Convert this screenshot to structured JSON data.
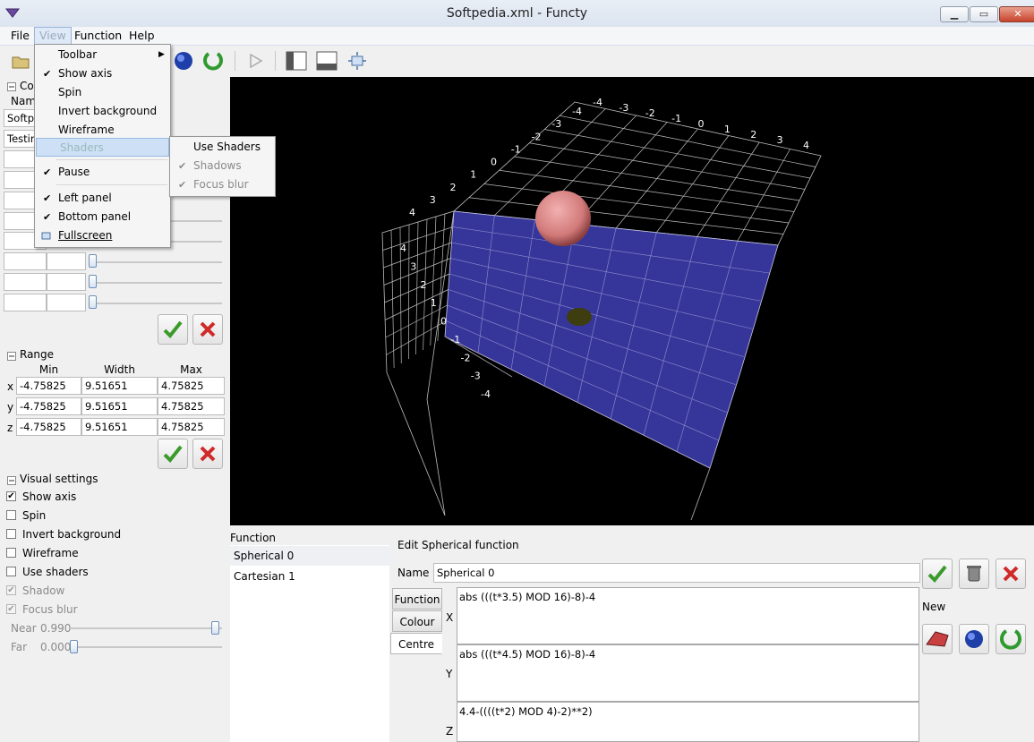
{
  "window": {
    "title": "Softpedia.xml - Functy"
  },
  "menubar": {
    "file": "File",
    "view": "View",
    "function": "Function",
    "help": "Help"
  },
  "view_menu": {
    "toolbar": "Toolbar",
    "show_axis": "Show axis",
    "spin": "Spin",
    "invert_background": "Invert background",
    "wireframe": "Wireframe",
    "shaders": "Shaders",
    "pause": "Pause",
    "left_panel": "Left panel",
    "bottom_panel": "Bottom panel",
    "fullscreen": "Fullscreen"
  },
  "shaders_menu": {
    "use_shaders": "Use Shaders",
    "shadows": "Shadows",
    "focus_blur": "Focus blur"
  },
  "left": {
    "controls_header": "Co",
    "name_header": "Nam",
    "rows": [
      "Softp",
      "Testin"
    ]
  },
  "range": {
    "title": "Range",
    "headers": {
      "min": "Min",
      "width": "Width",
      "max": "Max"
    },
    "rows": [
      {
        "axis": "x",
        "min": "-4.75825",
        "width": "9.51651",
        "max": "4.75825"
      },
      {
        "axis": "y",
        "min": "-4.75825",
        "width": "9.51651",
        "max": "4.75825"
      },
      {
        "axis": "z",
        "min": "-4.75825",
        "width": "9.51651",
        "max": "4.75825"
      }
    ]
  },
  "visual": {
    "title": "Visual settings",
    "show_axis": "Show axis",
    "spin": "Spin",
    "invert_background": "Invert background",
    "wireframe": "Wireframe",
    "use_shaders": "Use shaders",
    "shadow": "Shadow",
    "focus_blur": "Focus blur",
    "near_label": "Near",
    "near_value": "0.990",
    "far_label": "Far",
    "far_value": "0.000",
    "near_level": 0.98,
    "far_level": 0.0
  },
  "functions": {
    "header": "Function",
    "items": [
      "Spherical 0",
      "Cartesian 1"
    ]
  },
  "edit": {
    "title": "Edit Spherical function",
    "name_label": "Name",
    "name_value": "Spherical 0",
    "tabs": {
      "function": "Function",
      "colour": "Colour",
      "centre": "Centre"
    },
    "x_label": "X",
    "y_label": "Y",
    "z_label": "Z",
    "x_expr": "abs (((t*3.5) MOD 16)-8)-4",
    "y_expr": "abs (((t*4.5) MOD 16)-8)-4",
    "z_expr": "4.4-((((t*2) MOD 4)-2)**2)",
    "new_label": "New"
  },
  "axis_ticks": {
    "top": [
      "-4",
      "-3",
      "-2",
      "-1",
      "0",
      "1",
      "2",
      "3",
      "4"
    ],
    "back_diag": [
      "-4",
      "-3",
      "-2",
      "-1",
      "0",
      "1",
      "2",
      "3",
      "4"
    ],
    "left_vertical": [
      "4",
      "3",
      "2",
      "1",
      "0",
      "-1",
      "-2",
      "-3",
      "-4"
    ]
  },
  "colors": {
    "floor": "#3a3a9a",
    "sphere": "#d98585",
    "accent_green": "#3a9a2a",
    "accent_red": "#d02a2a"
  }
}
